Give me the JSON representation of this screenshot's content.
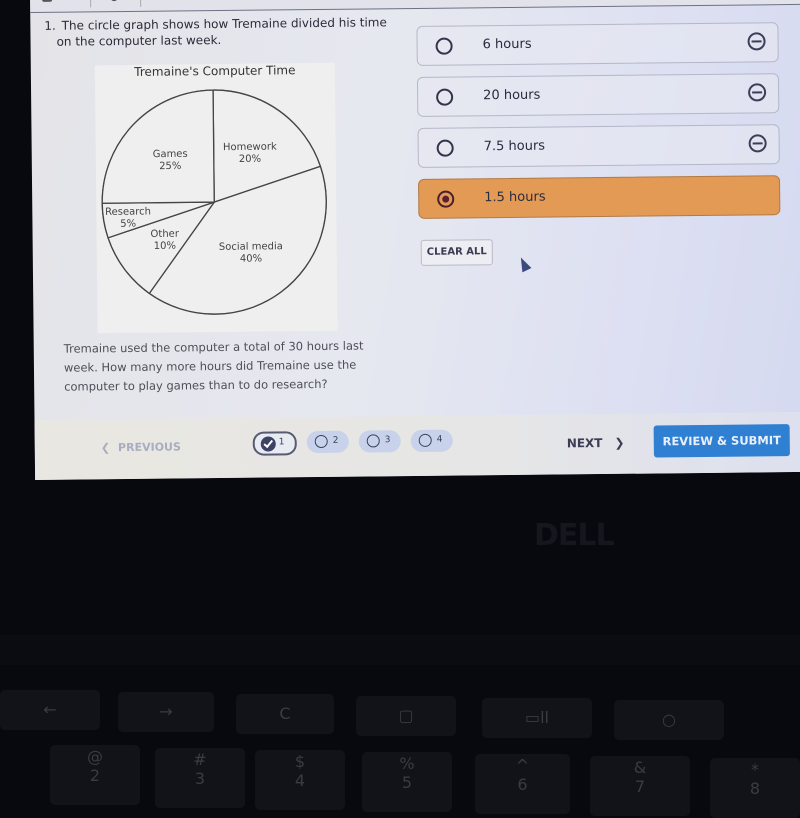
{
  "question": {
    "number": "1.",
    "title_line1": "The circle graph shows how Tremaine divided his time",
    "title_line2": "on the computer last week.",
    "prompt": "Tremaine used the computer a total of 30 hours last week. How many more hours did Tremaine use the computer to play games than to do research?"
  },
  "chart_data": {
    "type": "pie",
    "title": "Tremaine's Computer Time",
    "slices": [
      {
        "label": "Homework",
        "value": 20,
        "value_label": "20%"
      },
      {
        "label": "Social media",
        "value": 40,
        "value_label": "40%"
      },
      {
        "label": "Other",
        "value": 10,
        "value_label": "10%"
      },
      {
        "label": "Research",
        "value": 5,
        "value_label": "5%"
      },
      {
        "label": "Games",
        "value": 25,
        "value_label": "25%"
      }
    ],
    "start_angle_deg": 0,
    "direction": "clockwise"
  },
  "options": [
    {
      "label": "6 hours",
      "selected": false
    },
    {
      "label": "20 hours",
      "selected": false
    },
    {
      "label": "7.5 hours",
      "selected": false
    },
    {
      "label": "1.5 hours",
      "selected": true
    }
  ],
  "colors": {
    "selected_option": "#e39a55",
    "submit_button": "#2f7fd2"
  },
  "controls": {
    "clear_all": "CLEAR ALL",
    "previous": "PREVIOUS",
    "next": "NEXT",
    "review_submit": "REVIEW & SUBMIT",
    "chev_left": "❮",
    "chev_right": "❯"
  },
  "pager": [
    {
      "num": "1",
      "answered": true,
      "current": true
    },
    {
      "num": "2",
      "answered": false,
      "current": false
    },
    {
      "num": "3",
      "answered": false,
      "current": false
    },
    {
      "num": "4",
      "answered": false,
      "current": false
    }
  ],
  "device": {
    "logo": "DELL",
    "keys_top": [
      "←",
      "→",
      "C",
      "▢",
      "▭ll",
      "○"
    ],
    "keys_num_top": [
      "@",
      "#",
      "$",
      "%",
      "^",
      "&",
      "*"
    ],
    "keys_num_bottom": [
      "2",
      "3",
      "4",
      "5",
      "6",
      "7",
      "8"
    ]
  }
}
